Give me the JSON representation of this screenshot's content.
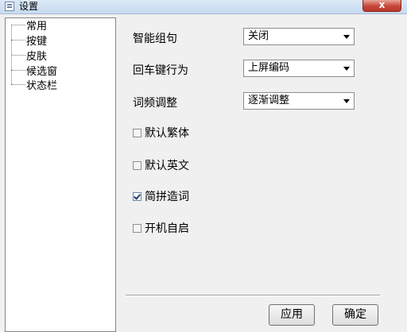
{
  "window": {
    "title": "设置",
    "close_glyph": "x"
  },
  "sidebar": {
    "items": [
      {
        "label": "常用"
      },
      {
        "label": "按键"
      },
      {
        "label": "皮肤"
      },
      {
        "label": "候选窗"
      },
      {
        "label": "状态栏"
      }
    ]
  },
  "settings": {
    "smart_compose": {
      "label": "智能组句",
      "value": "关闭"
    },
    "enter_behavior": {
      "label": "回车键行为",
      "value": "上屏编码"
    },
    "freq_adjust": {
      "label": "词频调整",
      "value": "逐渐调整"
    }
  },
  "checkboxes": [
    {
      "label": "默认繁体",
      "checked": false
    },
    {
      "label": "默认英文",
      "checked": false
    },
    {
      "label": "简拼造词",
      "checked": true
    },
    {
      "label": "开机自启",
      "checked": false
    }
  ],
  "buttons": {
    "apply": "应用",
    "ok": "确定"
  }
}
